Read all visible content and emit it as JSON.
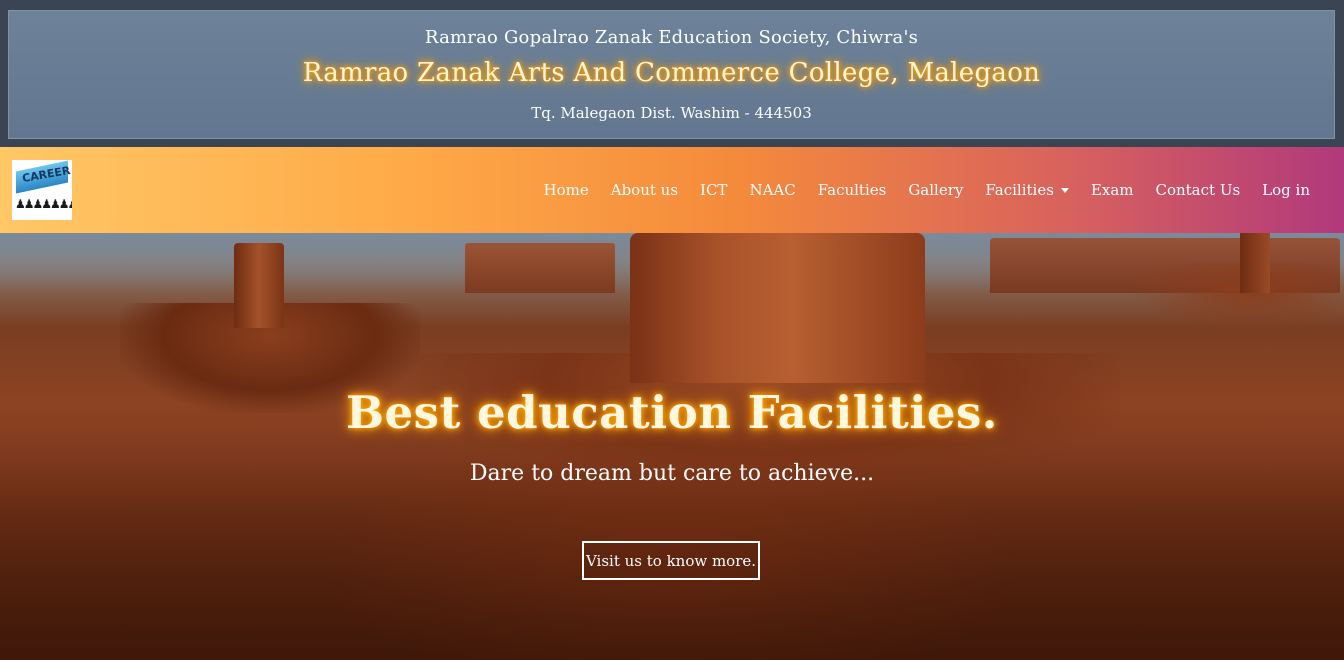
{
  "header": {
    "society": "Ramrao Gopalrao Zanak Education Society, Chiwra's",
    "college": "Ramrao Zanak Arts And Commerce College, Malegaon",
    "address": "Tq. Malegaon Dist. Washim - 444503"
  },
  "logo": {
    "text": "CAREER",
    "icon": "career-logo-icon"
  },
  "nav": {
    "items": [
      {
        "label": "Home"
      },
      {
        "label": "About us"
      },
      {
        "label": "ICT"
      },
      {
        "label": "NAAC"
      },
      {
        "label": "Faculties"
      },
      {
        "label": "Gallery"
      },
      {
        "label": "Facilities"
      },
      {
        "label": "Exam"
      },
      {
        "label": "Contact Us"
      },
      {
        "label": "Log in"
      }
    ]
  },
  "hero": {
    "title": "Best education Facilities.",
    "subtitle": "Dare to dream but care to achieve...",
    "button_label": "Visit us to know more."
  },
  "colors": {
    "header_bg": "#6d8299",
    "nav_gradient_start": "#ffc766",
    "nav_gradient_end": "#b1397c",
    "glow": "#ffb300"
  }
}
